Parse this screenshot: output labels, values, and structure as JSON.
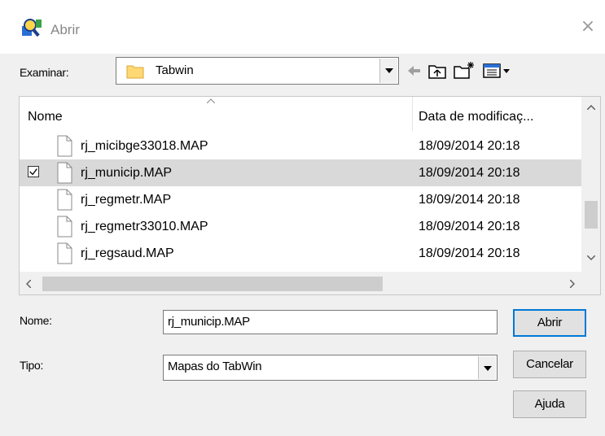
{
  "window": {
    "title": "Abrir",
    "close_glyph": "×"
  },
  "lookin": {
    "label": "Examinar:",
    "folder": "Tabwin"
  },
  "toolbar": {
    "icons": [
      "back-arrow-icon",
      "up-folder-icon",
      "new-folder-icon",
      "view-menu-icon"
    ]
  },
  "list": {
    "columns": {
      "name": "Nome",
      "date": "Data de modificaç..."
    },
    "rows": [
      {
        "name": "rj_micibge33018.MAP",
        "date": "18/09/2014 20:18",
        "selected": false
      },
      {
        "name": "rj_municip.MAP",
        "date": "18/09/2014 20:18",
        "selected": true
      },
      {
        "name": "rj_regmetr.MAP",
        "date": "18/09/2014 20:18",
        "selected": false
      },
      {
        "name": "rj_regmetr33010.MAP",
        "date": "18/09/2014 20:18",
        "selected": false
      },
      {
        "name": "rj_regsaud.MAP",
        "date": "18/09/2014 20:18",
        "selected": false
      }
    ]
  },
  "form": {
    "name_label": "Nome:",
    "name_value": "rj_municip.MAP",
    "type_label": "Tipo:",
    "type_value": "Mapas do TabWin"
  },
  "buttons": {
    "open": "Abrir",
    "cancel": "Cancelar",
    "help": "Ajuda"
  },
  "colors": {
    "selection": "#d9d9d9",
    "accent": "#0078d7",
    "client": "#f0f0f0"
  }
}
